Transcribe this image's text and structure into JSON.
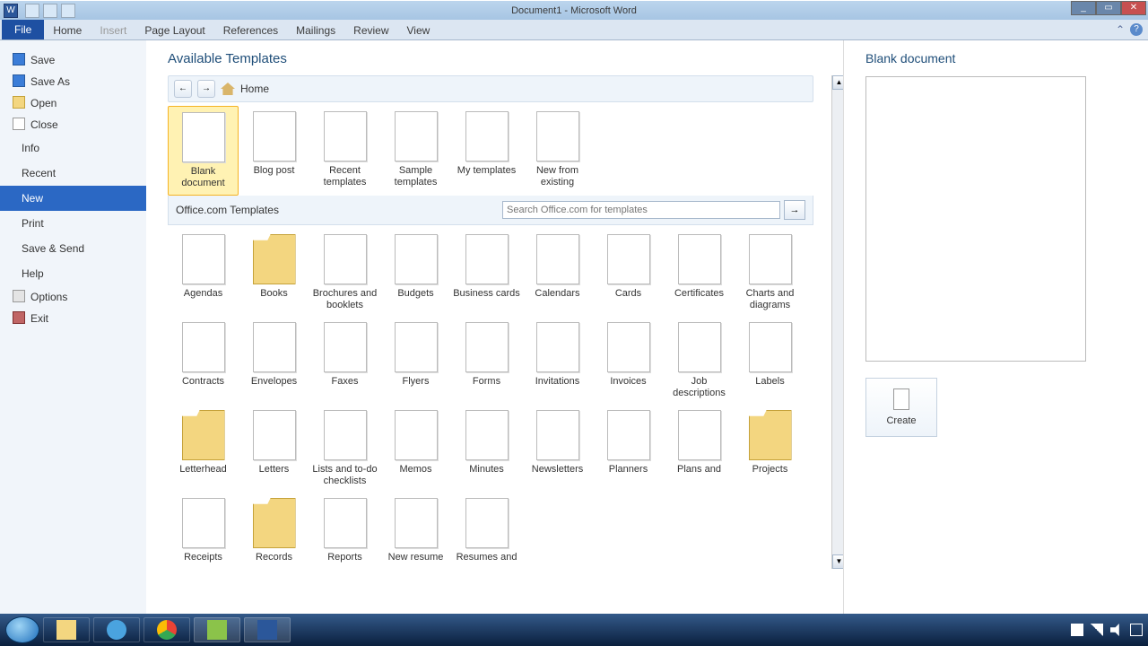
{
  "window": {
    "title": "Document1 - Microsoft Word",
    "min": "_",
    "max": "▭",
    "close": "✕"
  },
  "ribbon": {
    "file": "File",
    "tabs": [
      "Home",
      "Insert",
      "Page Layout",
      "References",
      "Mailings",
      "Review",
      "View"
    ]
  },
  "backstage_nav": {
    "save": "Save",
    "save_as": "Save As",
    "open": "Open",
    "close": "Close",
    "info": "Info",
    "recent": "Recent",
    "new": "New",
    "print": "Print",
    "save_send": "Save & Send",
    "help": "Help",
    "options": "Options",
    "exit": "Exit"
  },
  "templates": {
    "heading": "Available Templates",
    "breadcrumb_home": "Home",
    "nav_back": "←",
    "nav_fwd": "→",
    "local": [
      "Blank document",
      "Blog post",
      "Recent templates",
      "Sample templates",
      "My templates",
      "New from existing"
    ],
    "office_label": "Office.com Templates",
    "search_placeholder": "Search Office.com for templates",
    "go": "→",
    "categories": [
      "Agendas",
      "Books",
      "Brochures and booklets",
      "Budgets",
      "Business cards",
      "Calendars",
      "Cards",
      "Certificates",
      "Charts and diagrams",
      "Contracts",
      "Envelopes",
      "Faxes",
      "Flyers",
      "Forms",
      "Invitations",
      "Invoices",
      "Job descriptions",
      "Labels",
      "Letterhead",
      "Letters",
      "Lists and to-do checklists",
      "Memos",
      "Minutes",
      "Newsletters",
      "Planners",
      "Plans and",
      "Projects",
      "Receipts",
      "Records",
      "Reports",
      "New resume",
      "Resumes and"
    ],
    "folder_indices": [
      1,
      18,
      26,
      28
    ]
  },
  "preview": {
    "title": "Blank document",
    "create": "Create"
  },
  "taskbar": {
    "items": [
      "explorer",
      "ie",
      "chrome",
      "camtasia",
      "word"
    ]
  }
}
